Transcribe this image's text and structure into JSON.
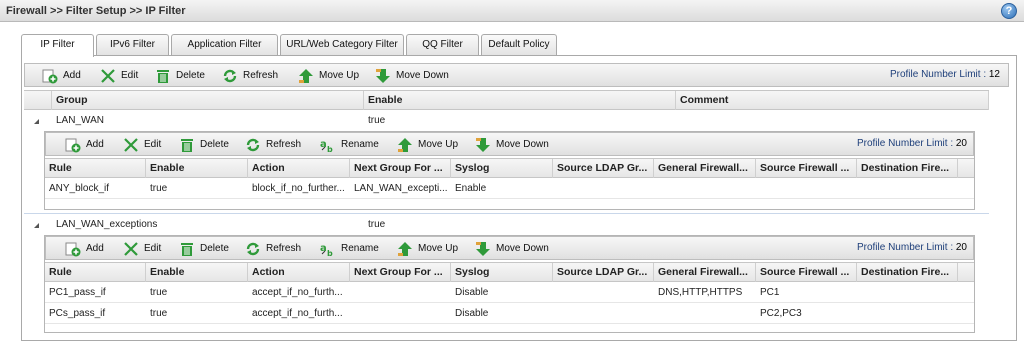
{
  "page": {
    "breadcrumb": "Firewall >> Filter Setup >> IP Filter"
  },
  "tabs": [
    {
      "label": "IP Filter",
      "active": true
    },
    {
      "label": "IPv6 Filter",
      "active": false
    },
    {
      "label": "Application Filter",
      "active": false
    },
    {
      "label": "URL/Web Category Filter",
      "active": false
    },
    {
      "label": "QQ Filter",
      "active": false
    },
    {
      "label": "Default Policy",
      "active": false
    }
  ],
  "toolbar": {
    "add": "Add",
    "edit": "Edit",
    "delete": "Delete",
    "refresh": "Refresh",
    "rename": "Rename",
    "move_up": "Move Up",
    "move_down": "Move Down",
    "limit_label": "Profile Number Limit :",
    "main_limit": "12",
    "group_limit": "20"
  },
  "group_table": {
    "columns": [
      "Group",
      "Enable",
      "Comment"
    ]
  },
  "rule_columns": [
    "Rule",
    "Enable",
    "Action",
    "Next Group For ...",
    "Syslog",
    "Source LDAP Gr...",
    "General Firewall...",
    "Source Firewall ...",
    "Destination Fire..."
  ],
  "groups": [
    {
      "name": "LAN_WAN",
      "enable": "true",
      "rules": [
        {
          "rule": "ANY_block_if",
          "enable": "true",
          "action": "block_if_no_further...",
          "next_group": "LAN_WAN_excepti...",
          "syslog": "Enable",
          "ldap": "",
          "general": "",
          "source_fw": "",
          "dest_fw": ""
        }
      ]
    },
    {
      "name": "LAN_WAN_exceptions",
      "enable": "true",
      "rules": [
        {
          "rule": "PC1_pass_if",
          "enable": "true",
          "action": "accept_if_no_furth...",
          "next_group": "",
          "syslog": "Disable",
          "ldap": "",
          "general": "DNS,HTTP,HTTPS",
          "source_fw": "PC1",
          "dest_fw": ""
        },
        {
          "rule": "PCs_pass_if",
          "enable": "true",
          "action": "accept_if_no_furth...",
          "next_group": "",
          "syslog": "Disable",
          "ldap": "",
          "general": "",
          "source_fw": "PC2,PC3",
          "dest_fw": ""
        }
      ]
    }
  ],
  "icons": {
    "add": "add-icon",
    "edit": "edit-icon",
    "delete": "trash-icon",
    "refresh": "refresh-icon",
    "rename": "rename-icon",
    "move_up": "arrow-up-icon",
    "move_down": "arrow-down-icon",
    "help": "help-icon"
  },
  "colors": {
    "icon_green": "#2f9a3a",
    "limit_text": "#1e3f7a",
    "help_blue": "#2d6fb7"
  }
}
